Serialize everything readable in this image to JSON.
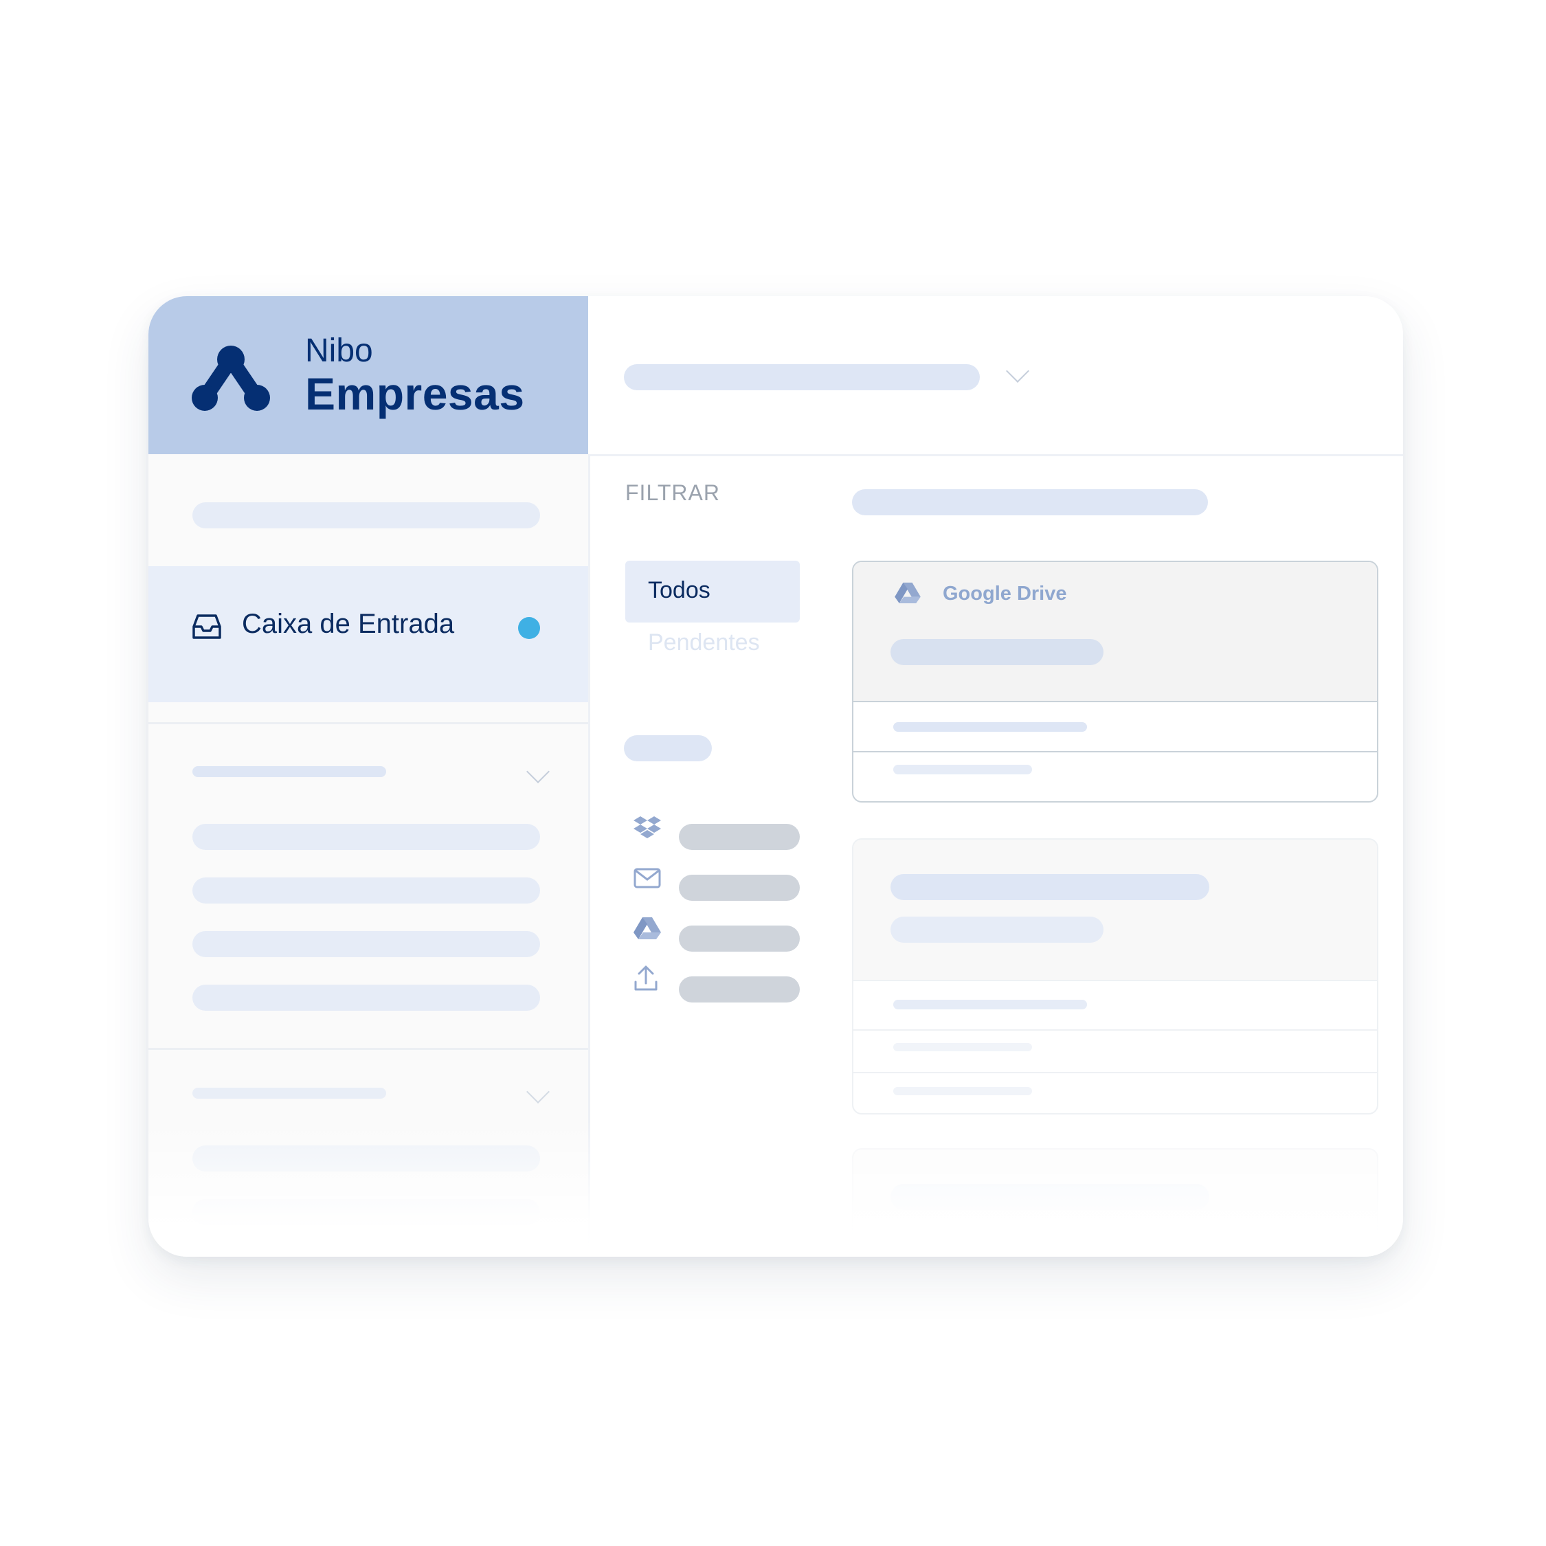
{
  "brand": {
    "name_top": "Nibo",
    "name_bottom": "Empresas",
    "color": "#052f73",
    "background": "#b8cbe8"
  },
  "sidebar": {
    "active_item": {
      "label": "Caixa de Entrada",
      "icon": "inbox-icon",
      "has_notification": true,
      "notification_color": "#3fb0e4"
    }
  },
  "filter": {
    "title": "FILTRAR",
    "options": [
      {
        "label": "Todos",
        "selected": true
      },
      {
        "label": "Pendentes",
        "selected": false
      }
    ],
    "sources": [
      {
        "icon": "dropbox-icon"
      },
      {
        "icon": "mail-icon"
      },
      {
        "icon": "google-drive-icon"
      },
      {
        "icon": "upload-icon"
      }
    ]
  },
  "documents": [
    {
      "source": "Google Drive",
      "icon": "google-drive-icon"
    }
  ],
  "colors": {
    "accent": "#052f73",
    "placeholder": "#dee6f5",
    "notification": "#3fb0e4"
  }
}
